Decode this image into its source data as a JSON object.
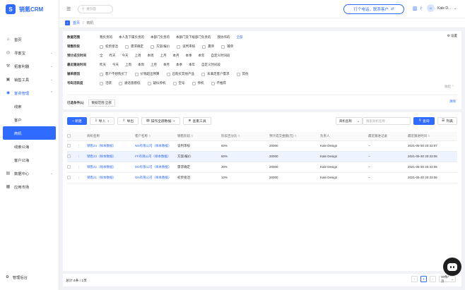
{
  "app": {
    "name": "销氪CRM",
    "logo_letter": "S"
  },
  "sidebar": {
    "items": [
      {
        "label": "首页",
        "icon": "home-icon",
        "glyph": "⌂"
      },
      {
        "label": "寻客宝",
        "icon": "target-icon",
        "glyph": "◎",
        "chev": "⌄"
      },
      {
        "label": "拓客利器",
        "icon": "tool-icon",
        "glyph": "⚒",
        "chev": "⌄"
      },
      {
        "label": "销售工具",
        "icon": "briefcase-icon",
        "glyph": "▣",
        "chev": "⌄"
      },
      {
        "label": "客资管理",
        "icon": "users-icon",
        "glyph": "◉",
        "chev": "⌃"
      }
    ],
    "sub_items": [
      "线索",
      "客户",
      "商机",
      "线索公海",
      "客户公海"
    ],
    "items2": [
      {
        "label": "数据中心",
        "icon": "chart-icon",
        "glyph": "▤",
        "chev": "⌄"
      },
      {
        "label": "应用市场",
        "icon": "grid-icon",
        "glyph": "▦"
      }
    ],
    "bottom_label": "管理后台",
    "bottom_glyph": "⚙"
  },
  "topbar": {
    "menu_glyph": "☰",
    "search_placeholder": "搜页面",
    "search_glyph": "⚲",
    "call_label": "打个电话，联系客户",
    "call_arrow": "⇄",
    "icon1_glyph": "▥",
    "icon2_glyph": "♪",
    "user_name": "Kale D...",
    "user_chev": "⌄",
    "avatar_glyph": "☺"
  },
  "tabbar": {
    "back_glyph": "‹",
    "crumbs": [
      "首页",
      "/",
      "商机"
    ]
  },
  "filter": {
    "rows": [
      {
        "label": "数据范围",
        "options": [
          "我负责的",
          "本人及下属负责的",
          "本部门负责的",
          "本部门及下级部门负责的",
          "我协作的",
          "全部"
        ],
        "active": 5,
        "type": "text"
      },
      {
        "label": "销售阶段",
        "options": [
          "初步接洽",
          "需求确定",
          "方案/报价",
          "谈判审核",
          "赢单",
          "输单"
        ],
        "type": "check"
      },
      {
        "label": "预计成交时间",
        "options": [
          "全",
          "昨天",
          "今天",
          "上周",
          "本周",
          "上月",
          "本月",
          "本季",
          "本年",
          "自定义时间段"
        ],
        "type": "text"
      },
      {
        "label": "最近跟进时间",
        "options": [
          "昨天",
          "今天",
          "上周",
          "本周",
          "上月",
          "本月",
          "本季",
          "本年",
          "自定义时间段"
        ],
        "type": "text"
      },
      {
        "label": "输单原因",
        "options": [
          "客户不想购买了",
          "价钱超出预算",
          "已购买其他产品",
          "未满足客户需求",
          "其他"
        ],
        "type": "check"
      },
      {
        "label": "号码活跃度",
        "options": [
          "活跃",
          "通话意愿低",
          "疑似停机",
          "空号",
          "停机",
          "不推荐"
        ],
        "type": "check"
      }
    ],
    "setting_label": "⚙ 设置",
    "collapse_label": "收起 ⌃",
    "selected_label": "已选条件(1)",
    "selected_chip": "数据范围:全部",
    "clear_label": "清除"
  },
  "toolbar": {
    "new_label": "+ 新建",
    "import_label": "导入",
    "import_glyph": "⇩",
    "export_label": "导出",
    "export_glyph": "⇧",
    "ops_label": "操作全部数据",
    "ops_glyph": "▤",
    "dupe_label": "查重工具",
    "dupe_glyph": "⊕",
    "chev": "⌄",
    "field_select": "商机名称",
    "keyword_placeholder": "搜索商机名称",
    "query_label": "查询",
    "query_glyph": "⚲",
    "list_label": "列表",
    "list_glyph": "☰"
  },
  "table": {
    "headers": [
      "",
      "",
      "商机名称",
      "客户名称",
      "销售阶段",
      "阶段百分比",
      "预计成交金额(元)",
      "负责人",
      "最近跟进记录",
      "最近跟进时间"
    ],
    "rows": [
      {
        "name": "销售24（样本数据）",
        "customer": "NN有限公司（样本数据）",
        "stage": "谈判审核",
        "pct": "60%",
        "amount": "20000",
        "owner": "Kale Design",
        "record": "--",
        "time": "2021-05-30 20:33:07"
      },
      {
        "name": "销售23（样本数据）",
        "customer": "FF有限公司（样本数据）",
        "stage": "方案/报价",
        "pct": "50%",
        "amount": "20000",
        "owner": "Kale Design",
        "record": "--",
        "time": "2021-05-30 20:33:06"
      },
      {
        "name": "销售22（样本数据）",
        "customer": "DD有限公司（样本数据）",
        "stage": "需求确定",
        "pct": "30%",
        "amount": "20000",
        "owner": "Kale Design",
        "record": "--",
        "time": "2021-05-30 20:33:06"
      },
      {
        "name": "销售21（样本数据）",
        "customer": "NN有限公司（样本数据）",
        "stage": "初步接洽",
        "pct": "10%",
        "amount": "20000",
        "owner": "Kale Design",
        "record": "--",
        "time": "2021-05-30 20:33:06"
      }
    ],
    "row_menu": "⋮",
    "sort_glyph": "⇅"
  },
  "footer": {
    "total_label": "总计:4条 / 1页",
    "prev": "‹",
    "page": "1",
    "next": "›",
    "page_size": "10条/页",
    "size_chev": "⌄"
  },
  "colors": {
    "primary": "#2f6bff"
  }
}
